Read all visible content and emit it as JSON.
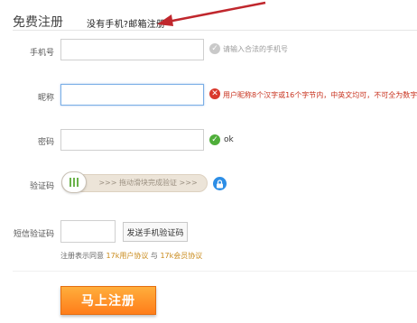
{
  "header": {
    "title": "免费注册",
    "email_register_link": "没有手机?邮箱注册"
  },
  "form": {
    "phone": {
      "label": "手机号",
      "value": "",
      "hint": "请输入合法的手机号"
    },
    "nickname": {
      "label": "昵称",
      "value": "",
      "error": "用户昵称8个汉字或16个字节内，中英文均可，不可全为数字"
    },
    "password": {
      "label": "密码",
      "value": "",
      "ok": "ok"
    },
    "captcha": {
      "label": "验证码",
      "slider_text": ">>> 拖动滑块完成验证 >>>"
    },
    "sms": {
      "label": "短信验证码",
      "value": "",
      "button": "发送手机验证码"
    }
  },
  "agreement": {
    "prefix": "注册表示同意",
    "link1": "17k用户协议",
    "joiner": "与",
    "link2": "17k会员协议"
  },
  "submit": {
    "label": "马上注册"
  },
  "colors": {
    "accent_orange": "#ff8a1f",
    "error_red": "#d9382c",
    "ok_green": "#4fae3a",
    "annotation_arrow": "#c0272d"
  }
}
